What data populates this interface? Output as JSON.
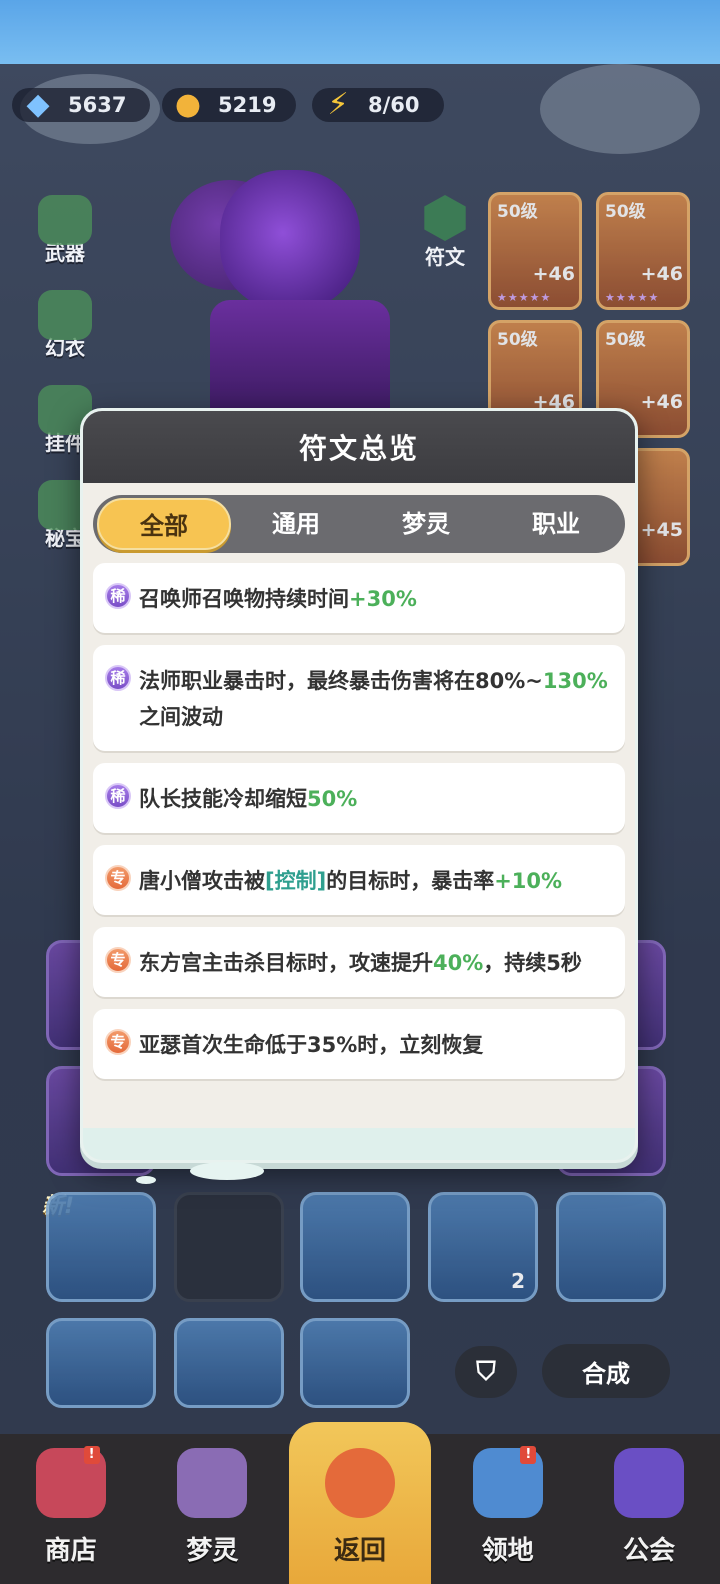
{
  "currency": {
    "gems": "5637",
    "coins": "5219",
    "energy": "8/60"
  },
  "side_menu": [
    "武器",
    "幻衣",
    "挂件",
    "秘宝"
  ],
  "rune_side_label": "符文",
  "equipment": [
    {
      "level": "50级",
      "plus": "+46"
    },
    {
      "level": "50级",
      "plus": "+46"
    },
    {
      "level": "50级",
      "plus": "+46"
    },
    {
      "level": "50级",
      "plus": "+46"
    },
    {
      "level": "",
      "plus": "+45"
    }
  ],
  "grid": {
    "new_label": "新!",
    "count_label": "2"
  },
  "buttons": {
    "merge": "合成",
    "filter_icon": "filter-icon"
  },
  "modal": {
    "title": "符文总览",
    "tabs": [
      "全部",
      "通用",
      "梦灵",
      "职业"
    ],
    "active_tab": "全部",
    "entries": [
      {
        "tag": "稀",
        "type": "rare",
        "parts": [
          "召唤师召唤物持续时间",
          "+30%",
          ""
        ]
      },
      {
        "tag": "稀",
        "type": "rare",
        "parts": [
          "法师职业暴击时，最终暴击伤害将在80%~",
          "130%",
          "之间波动"
        ]
      },
      {
        "tag": "稀",
        "type": "rare",
        "parts": [
          "队长技能冷却缩短",
          "50%",
          ""
        ]
      },
      {
        "tag": "专",
        "type": "pro",
        "parts": [
          "唐小僧攻击被",
          "[控制]",
          "的目标时，暴击率",
          "+10%"
        ]
      },
      {
        "tag": "专",
        "type": "pro",
        "parts": [
          "东方宫主击杀目标时，攻速提升",
          "40%",
          "，持续5秒"
        ]
      },
      {
        "tag": "专",
        "type": "pro",
        "parts": [
          "亚瑟首次生命低于35%时，立刻恢复",
          "",
          ""
        ]
      }
    ]
  },
  "bottom_nav": [
    {
      "label": "商店",
      "icon": "shop-icon",
      "badge": "!"
    },
    {
      "label": "梦灵",
      "icon": "spirit-icon",
      "badge": ""
    },
    {
      "label": "返回",
      "icon": "back-arrow-icon",
      "badge": ""
    },
    {
      "label": "领地",
      "icon": "territory-icon",
      "badge": "!"
    },
    {
      "label": "公会",
      "icon": "guild-icon",
      "badge": ""
    }
  ],
  "colors": {
    "highlight_green": "#4cb05a",
    "active_tab": "#f7c452",
    "rare_tag": "#8a5fd6",
    "pro_tag": "#ea7a48"
  }
}
